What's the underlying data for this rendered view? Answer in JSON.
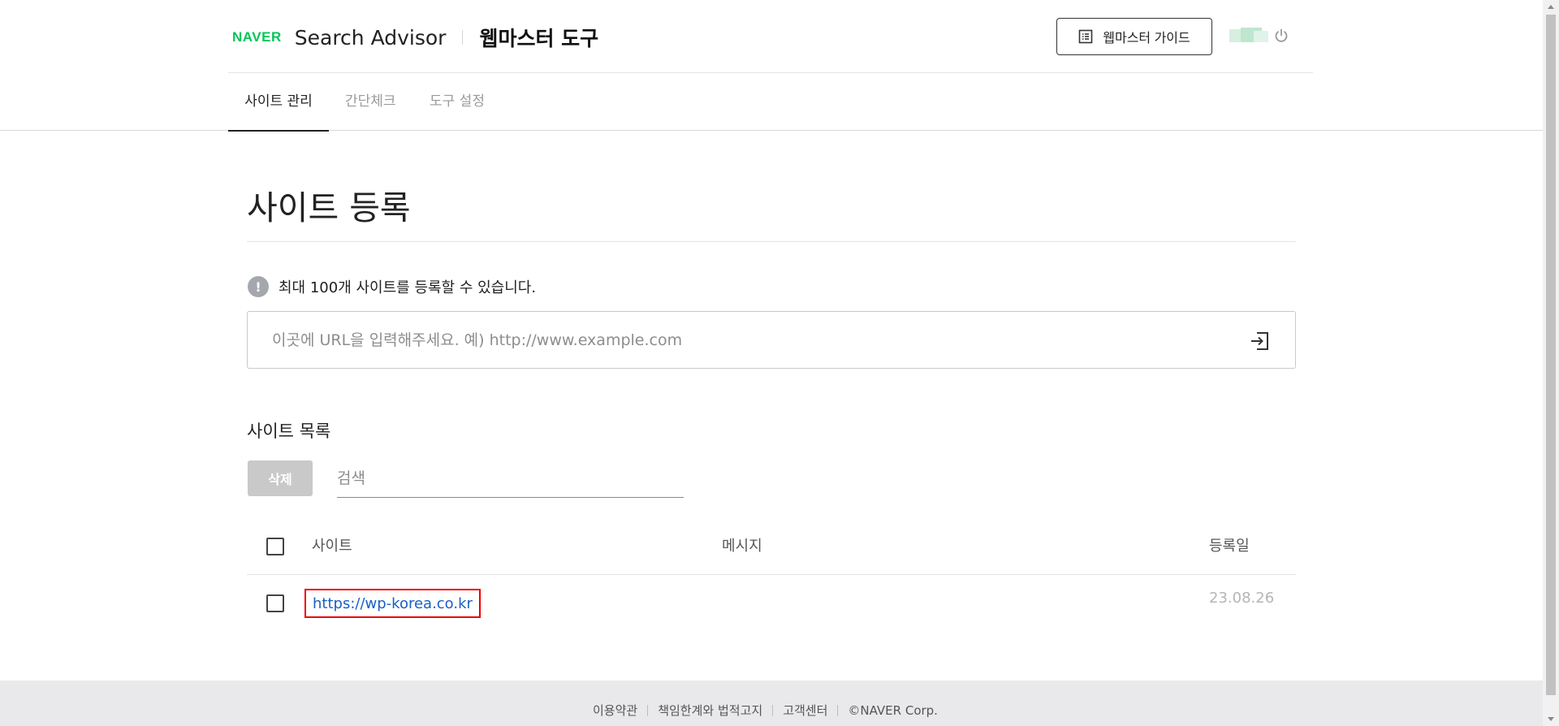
{
  "header": {
    "logo_text": "NAVER",
    "product_name": "Search Advisor",
    "product_sub": "웹마스터 도구",
    "guide_button": "웹마스터 가이드",
    "logout_icon": "power-icon"
  },
  "nav": {
    "tabs": [
      {
        "label": "사이트 관리",
        "active": true
      },
      {
        "label": "간단체크",
        "active": false
      },
      {
        "label": "도구 설정",
        "active": false
      }
    ]
  },
  "main": {
    "title": "사이트 등록",
    "notice": "최대 100개 사이트를 등록할 수 있습니다.",
    "notice_icon_glyph": "!",
    "url_input": {
      "value": "",
      "placeholder": "이곳에 URL을 입력해주세요. 예) http://www.example.com"
    },
    "site_list": {
      "title": "사이트 목록",
      "delete_button": "삭제",
      "search_placeholder": "검색",
      "columns": {
        "site": "사이트",
        "message": "메시지",
        "date": "등록일"
      },
      "rows": [
        {
          "site": "https://wp-korea.co.kr",
          "message": "",
          "date": "23.08.26"
        }
      ]
    }
  },
  "footer": {
    "links": [
      "이용약관",
      "책임한계와 법적고지",
      "고객센터"
    ],
    "copyright": "©NAVER Corp."
  },
  "colors": {
    "brand_green": "#03c75a",
    "link_blue": "#1a5fc4",
    "highlight_red": "#e00000"
  }
}
